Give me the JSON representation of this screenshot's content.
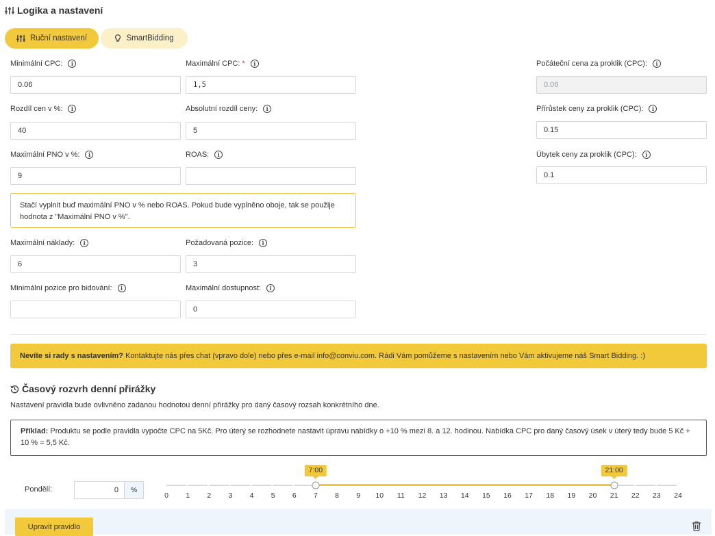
{
  "section_logic": {
    "title": "Logika a nastavení",
    "icon": "sliders-icon"
  },
  "mode_tabs": [
    {
      "label": "Ruční nastavení",
      "icon": "sliders-icon",
      "active": true
    },
    {
      "label": "SmartBidding",
      "icon": "lightbulb-icon",
      "active": false
    }
  ],
  "fields": {
    "min_cpc": {
      "label": "Minimální CPC:",
      "value": "0.06"
    },
    "max_cpc": {
      "label": "Maximální CPC:",
      "required_mark": "*",
      "value": "1,5"
    },
    "start_price": {
      "label": "Počáteční cena za proklik (CPC):",
      "value": "0.06"
    },
    "price_diff_pct": {
      "label": "Rozdíl cen v %:",
      "value": "40"
    },
    "abs_price_diff": {
      "label": "Absolutní rozdíl ceny:",
      "value": "5"
    },
    "price_increment": {
      "label": "Přírůstek ceny za proklik (CPC):",
      "value": "0.15"
    },
    "max_pno": {
      "label": "Maximální PNO v %:",
      "value": "9"
    },
    "roas": {
      "label": "ROAS:",
      "value": ""
    },
    "price_decrement": {
      "label": "Úbytek ceny za proklik (CPC):",
      "value": "0.1"
    },
    "max_costs": {
      "label": "Maximální náklady:",
      "value": "6"
    },
    "req_position": {
      "label": "Požadovaná pozice:",
      "value": "3"
    },
    "min_bid_position": {
      "label": "Minimální pozice pro bidování:",
      "value": ""
    },
    "max_availability": {
      "label": "Maximální dostupnost:",
      "value": "0"
    }
  },
  "pno_note": "Stačí vyplnit buď maximální PNO v % nebo ROAS. Pokud bude vyplněno oboje, tak se použije hodnota z \"Maximální PNO v %\".",
  "help_banner": {
    "bold": "Nevíte si rady s nastavením?",
    "text": " Kontaktujte nás přes chat (vpravo dole) nebo přes e-mail info@conviu.com. Rádi Vám pomůžeme s nastavením nebo Vám aktivujeme náš Smart Bidding. :)"
  },
  "schedule": {
    "title": "Časový rozvrh denní přirážky",
    "icon": "history-icon",
    "description": "Nastavení pravidla bude ovlivněno zadanou hodnotou denní přirážky pro daný časový rozsah konkrétního dne.",
    "example_bold": "Příklad:",
    "example_text": " Produktu se podle pravidla vypočte CPC na 5Kč. Pro úterý se rozhodnete nastavit úpravu nabídky o +10 % mezi 8. a 12. hodinou. Nabídka CPC pro daný časový úsek v úterý tedy bude 5 Kč + 10 % = 5,5 Kč.",
    "day_label": "Pondělí:",
    "day_value": "0",
    "unit": "%",
    "range_start": 7,
    "range_end": 21,
    "range_start_label": "7:00",
    "range_end_label": "21:00",
    "ticks": [
      "0",
      "1",
      "2",
      "3",
      "4",
      "5",
      "6",
      "7",
      "8",
      "9",
      "10",
      "11",
      "12",
      "13",
      "14",
      "15",
      "16",
      "17",
      "18",
      "19",
      "20",
      "21",
      "22",
      "23",
      "24"
    ]
  },
  "actions": {
    "edit_rule": "Upravit pravidlo",
    "delete_icon": "trash-icon"
  },
  "colors": {
    "accent": "#f3c93c",
    "accent_light": "#fbf0c8",
    "panel": "#eef5fc"
  }
}
